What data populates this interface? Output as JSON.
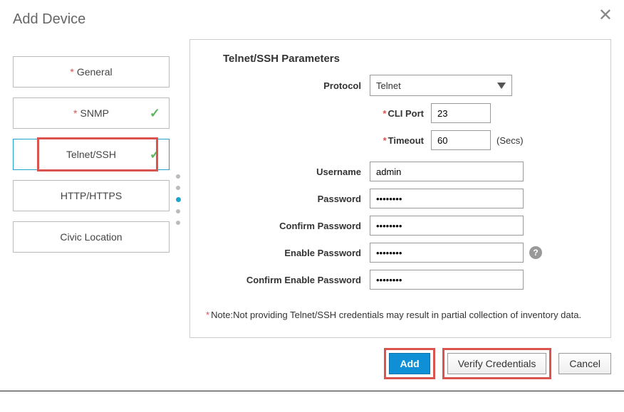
{
  "dialog": {
    "title": "Add Device"
  },
  "nav": {
    "items": [
      {
        "label": "General",
        "required": true,
        "checked": false,
        "active": false
      },
      {
        "label": "SNMP",
        "required": true,
        "checked": true,
        "active": false
      },
      {
        "label": "Telnet/SSH",
        "required": false,
        "checked": true,
        "active": true,
        "highlight": true
      },
      {
        "label": "HTTP/HTTPS",
        "required": false,
        "checked": false,
        "active": false
      },
      {
        "label": "Civic Location",
        "required": false,
        "checked": false,
        "active": false
      }
    ]
  },
  "panel": {
    "title": "Telnet/SSH Parameters",
    "protocol_label": "Protocol",
    "protocol_value": "Telnet",
    "cli_port_label": "CLI Port",
    "cli_port_value": "23",
    "timeout_label": "Timeout",
    "timeout_value": "60",
    "timeout_unit": "(Secs)",
    "username_label": "Username",
    "username_value": "admin",
    "password_label": "Password",
    "password_value": "••••••••",
    "confirm_password_label": "Confirm Password",
    "confirm_password_value": "••••••••",
    "enable_password_label": "Enable Password",
    "enable_password_value": "••••••••",
    "confirm_enable_password_label": "Confirm Enable Password",
    "confirm_enable_password_value": "••••••••",
    "note": "Note:Not providing Telnet/SSH credentials may result in partial collection of inventory data."
  },
  "footer": {
    "add": "Add",
    "verify": "Verify Credentials",
    "cancel": "Cancel"
  }
}
